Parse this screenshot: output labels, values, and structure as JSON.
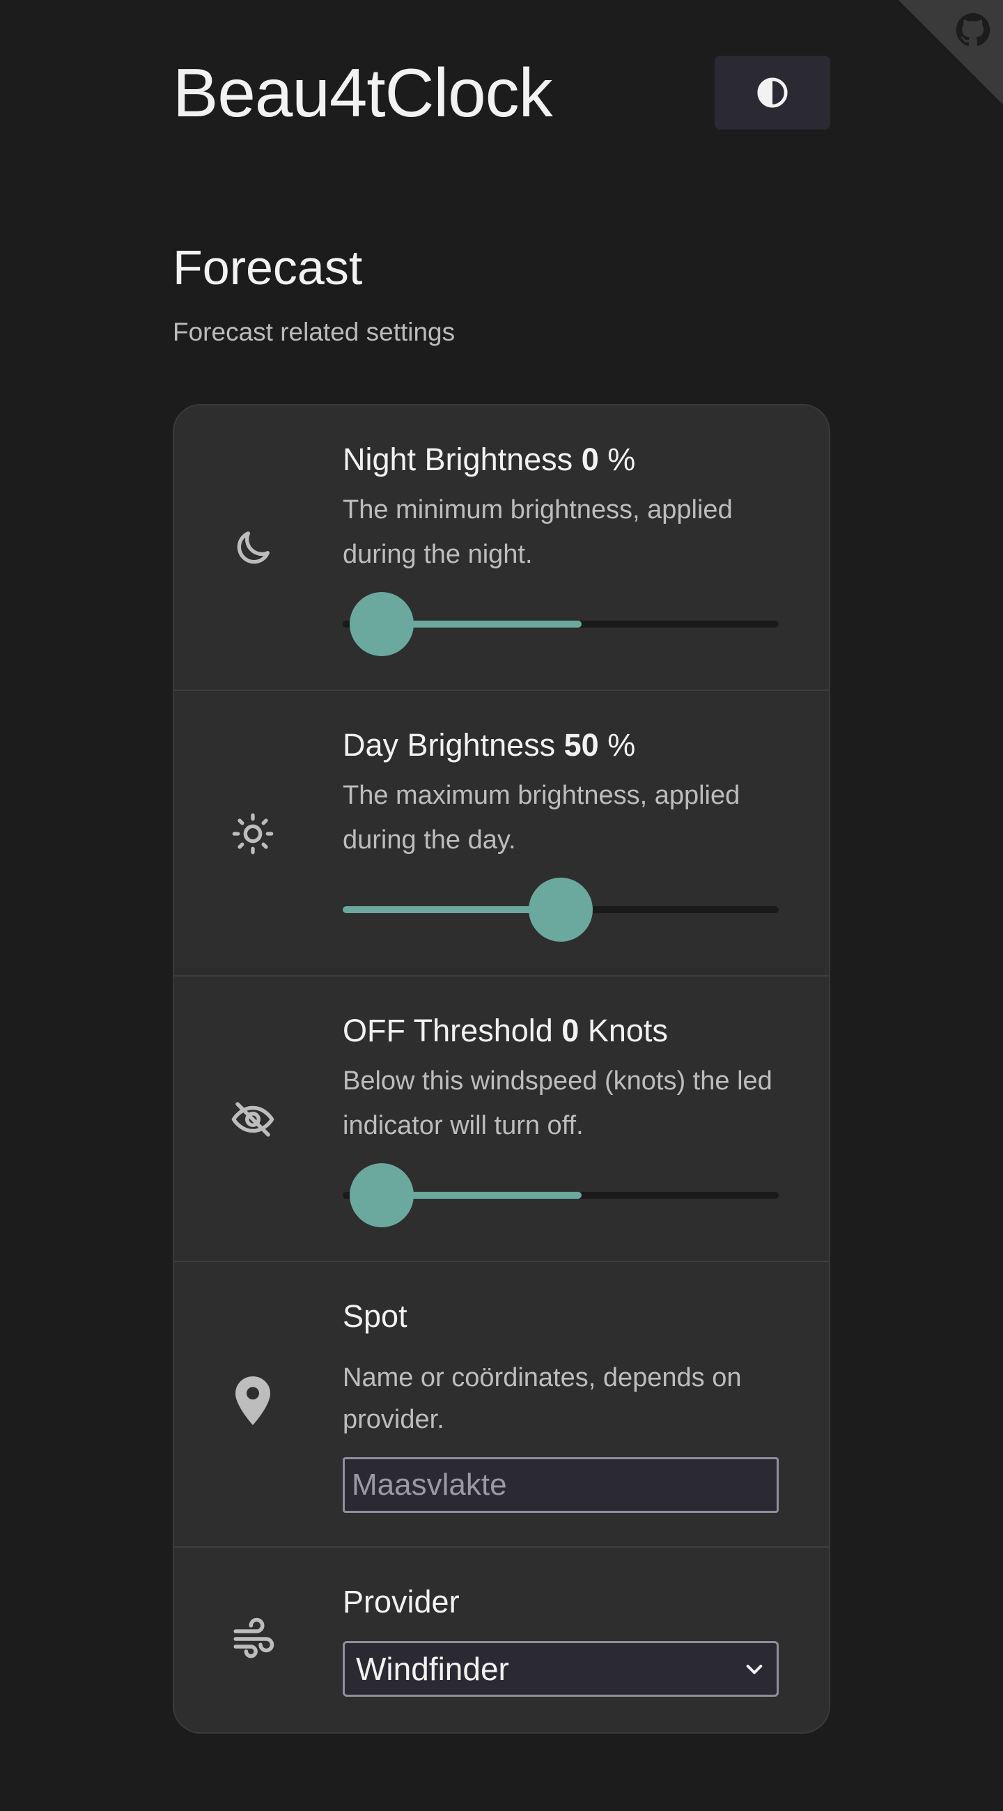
{
  "app": {
    "title": "Beau4tClock",
    "theme_toggle_icon": "half-circle-contrast-icon",
    "corner_icon": "github-octocat-icon"
  },
  "section": {
    "title": "Forecast",
    "subtitle": "Forecast related settings"
  },
  "settings": {
    "night_brightness": {
      "icon": "moon-icon",
      "label": "Night Brightness",
      "value": "0",
      "unit": "%",
      "description": "The minimum brightness, applied during the night.",
      "slider_fraction": 0
    },
    "day_brightness": {
      "icon": "sun-icon",
      "label": "Day Brightness",
      "value": "50",
      "unit": "%",
      "description": "The maximum brightness, applied during the day.",
      "slider_fraction": 0.5
    },
    "off_threshold": {
      "icon": "eye-off-icon",
      "label": "OFF Threshold",
      "value": "0",
      "unit": "Knots",
      "description": "Below this windspeed (knots) the led indicator will turn off.",
      "slider_fraction": 0
    },
    "spot": {
      "icon": "location-pin-icon",
      "label": "Spot",
      "description": "Name or coördinates, depends on provider.",
      "placeholder": "Maasvlakte",
      "value": ""
    },
    "provider": {
      "icon": "wind-icon",
      "label": "Provider",
      "selected": "Windfinder"
    }
  },
  "colors": {
    "background": "#1c1c1c",
    "card": "#2e2e2e",
    "accent": "#6ba89e",
    "input_bg": "#2b2a33"
  }
}
